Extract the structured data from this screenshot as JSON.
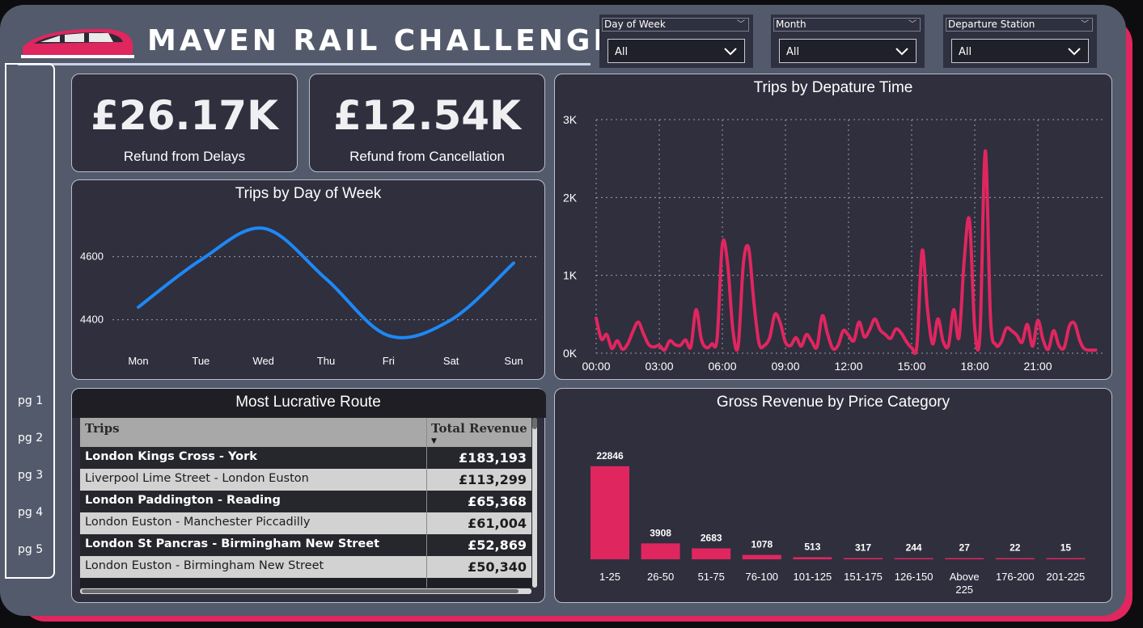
{
  "header": {
    "title": "MAVEN RAIL CHALLENGE"
  },
  "colors": {
    "accent": "#e0265f",
    "line_blue": "#1e88f5",
    "panel": "#2f2f3e",
    "frame": "#535a6b"
  },
  "filters": [
    {
      "label": "Day of Week",
      "value": "All"
    },
    {
      "label": "Month",
      "value": "All"
    },
    {
      "label": "Departure Station",
      "value": "All"
    }
  ],
  "nav": {
    "items": [
      "pg 1",
      "pg 2",
      "pg 3",
      "pg 4",
      "pg 5"
    ]
  },
  "kpis": [
    {
      "value": "£26.17K",
      "label": "Refund from Delays"
    },
    {
      "value": "£12.54K",
      "label": "Refund from Cancellation"
    }
  ],
  "table": {
    "title": "Most Lucrative Route",
    "columns": [
      "Trips",
      "Total Revenue"
    ],
    "rows": [
      {
        "route": "London Kings Cross - York",
        "revenue": "£183,193"
      },
      {
        "route": "Liverpool Lime Street - London Euston",
        "revenue": "£113,299"
      },
      {
        "route": "London Paddington - Reading",
        "revenue": "£65,368"
      },
      {
        "route": "London Euston - Manchester Piccadilly",
        "revenue": "£61,004"
      },
      {
        "route": "London St Pancras - Birmingham New Street",
        "revenue": "£52,869"
      },
      {
        "route": "London Euston - Birmingham New Street",
        "revenue": "£50,340"
      }
    ]
  },
  "chart_data": [
    {
      "type": "line",
      "title": "Trips by Day of Week",
      "categories": [
        "Mon",
        "Tue",
        "Wed",
        "Thu",
        "Fri",
        "Sat",
        "Sun"
      ],
      "values": [
        4440,
        4590,
        4690,
        4530,
        4350,
        4400,
        4580
      ],
      "yticks": [
        4400,
        4600
      ],
      "ylim": [
        4330,
        4740
      ],
      "grid": true
    },
    {
      "type": "line",
      "title": "Trips by Depature Time",
      "xticks": [
        "00:00",
        "03:00",
        "06:00",
        "09:00",
        "12:00",
        "15:00",
        "18:00",
        "21:00"
      ],
      "yticks": [
        "0K",
        "1K",
        "2K",
        "3K"
      ],
      "xlim": [
        0,
        24
      ],
      "ylim": [
        0,
        3000
      ],
      "grid": true,
      "x": [
        0,
        0.25,
        0.5,
        0.75,
        1,
        1.25,
        1.5,
        1.75,
        2,
        2.25,
        2.5,
        2.75,
        3,
        3.25,
        3.5,
        3.75,
        4,
        4.25,
        4.5,
        4.75,
        5,
        5.25,
        5.5,
        5.75,
        6,
        6.25,
        6.5,
        6.75,
        7,
        7.25,
        7.5,
        7.75,
        8,
        8.25,
        8.5,
        8.75,
        9,
        9.25,
        9.5,
        9.75,
        10,
        10.25,
        10.5,
        10.75,
        11,
        11.25,
        11.5,
        11.75,
        12,
        12.25,
        12.5,
        12.75,
        13,
        13.25,
        13.5,
        13.75,
        14,
        14.25,
        14.5,
        14.75,
        15,
        15.25,
        15.5,
        15.75,
        16,
        16.25,
        16.5,
        16.75,
        17,
        17.25,
        17.5,
        17.75,
        18,
        18.25,
        18.5,
        18.75,
        19,
        19.25,
        19.5,
        19.75,
        20,
        20.25,
        20.5,
        20.75,
        21,
        21.25,
        21.5,
        21.75,
        22,
        22.25,
        22.5,
        22.75,
        23,
        23.25,
        23.75
      ],
      "values": [
        450,
        180,
        240,
        60,
        160,
        50,
        120,
        280,
        400,
        250,
        110,
        80,
        100,
        40,
        160,
        110,
        100,
        170,
        80,
        560,
        180,
        70,
        120,
        190,
        1400,
        1150,
        300,
        90,
        1150,
        1350,
        650,
        120,
        100,
        200,
        500,
        390,
        140,
        100,
        200,
        90,
        240,
        150,
        80,
        480,
        250,
        60,
        100,
        290,
        230,
        160,
        400,
        210,
        300,
        440,
        300,
        240,
        190,
        310,
        260,
        150,
        70,
        100,
        1320,
        570,
        120,
        440,
        150,
        100,
        560,
        200,
        1200,
        1710,
        320,
        250,
        2600,
        450,
        110,
        140,
        320,
        290,
        230,
        140,
        370,
        90,
        420,
        170,
        50,
        290,
        100,
        70,
        350,
        380,
        160,
        50,
        40,
        60,
        400
      ]
    },
    {
      "type": "bar",
      "title": "Gross Revenue by Price Category",
      "categories": [
        "1-25",
        "26-50",
        "51-75",
        "76-100",
        "101-125",
        "151-175",
        "126-150",
        "Above 225",
        "176-200",
        "201-225"
      ],
      "category_lines": [
        [
          "1-25"
        ],
        [
          "26-50"
        ],
        [
          "51-75"
        ],
        [
          "76-100"
        ],
        [
          "101-125"
        ],
        [
          "151-175"
        ],
        [
          "126-150"
        ],
        [
          "Above",
          "225"
        ],
        [
          "176-200"
        ],
        [
          "201-225"
        ]
      ],
      "values": [
        22846,
        3908,
        2683,
        1078,
        513,
        317,
        244,
        27,
        22,
        15
      ],
      "ylim": [
        0,
        24000
      ]
    }
  ]
}
